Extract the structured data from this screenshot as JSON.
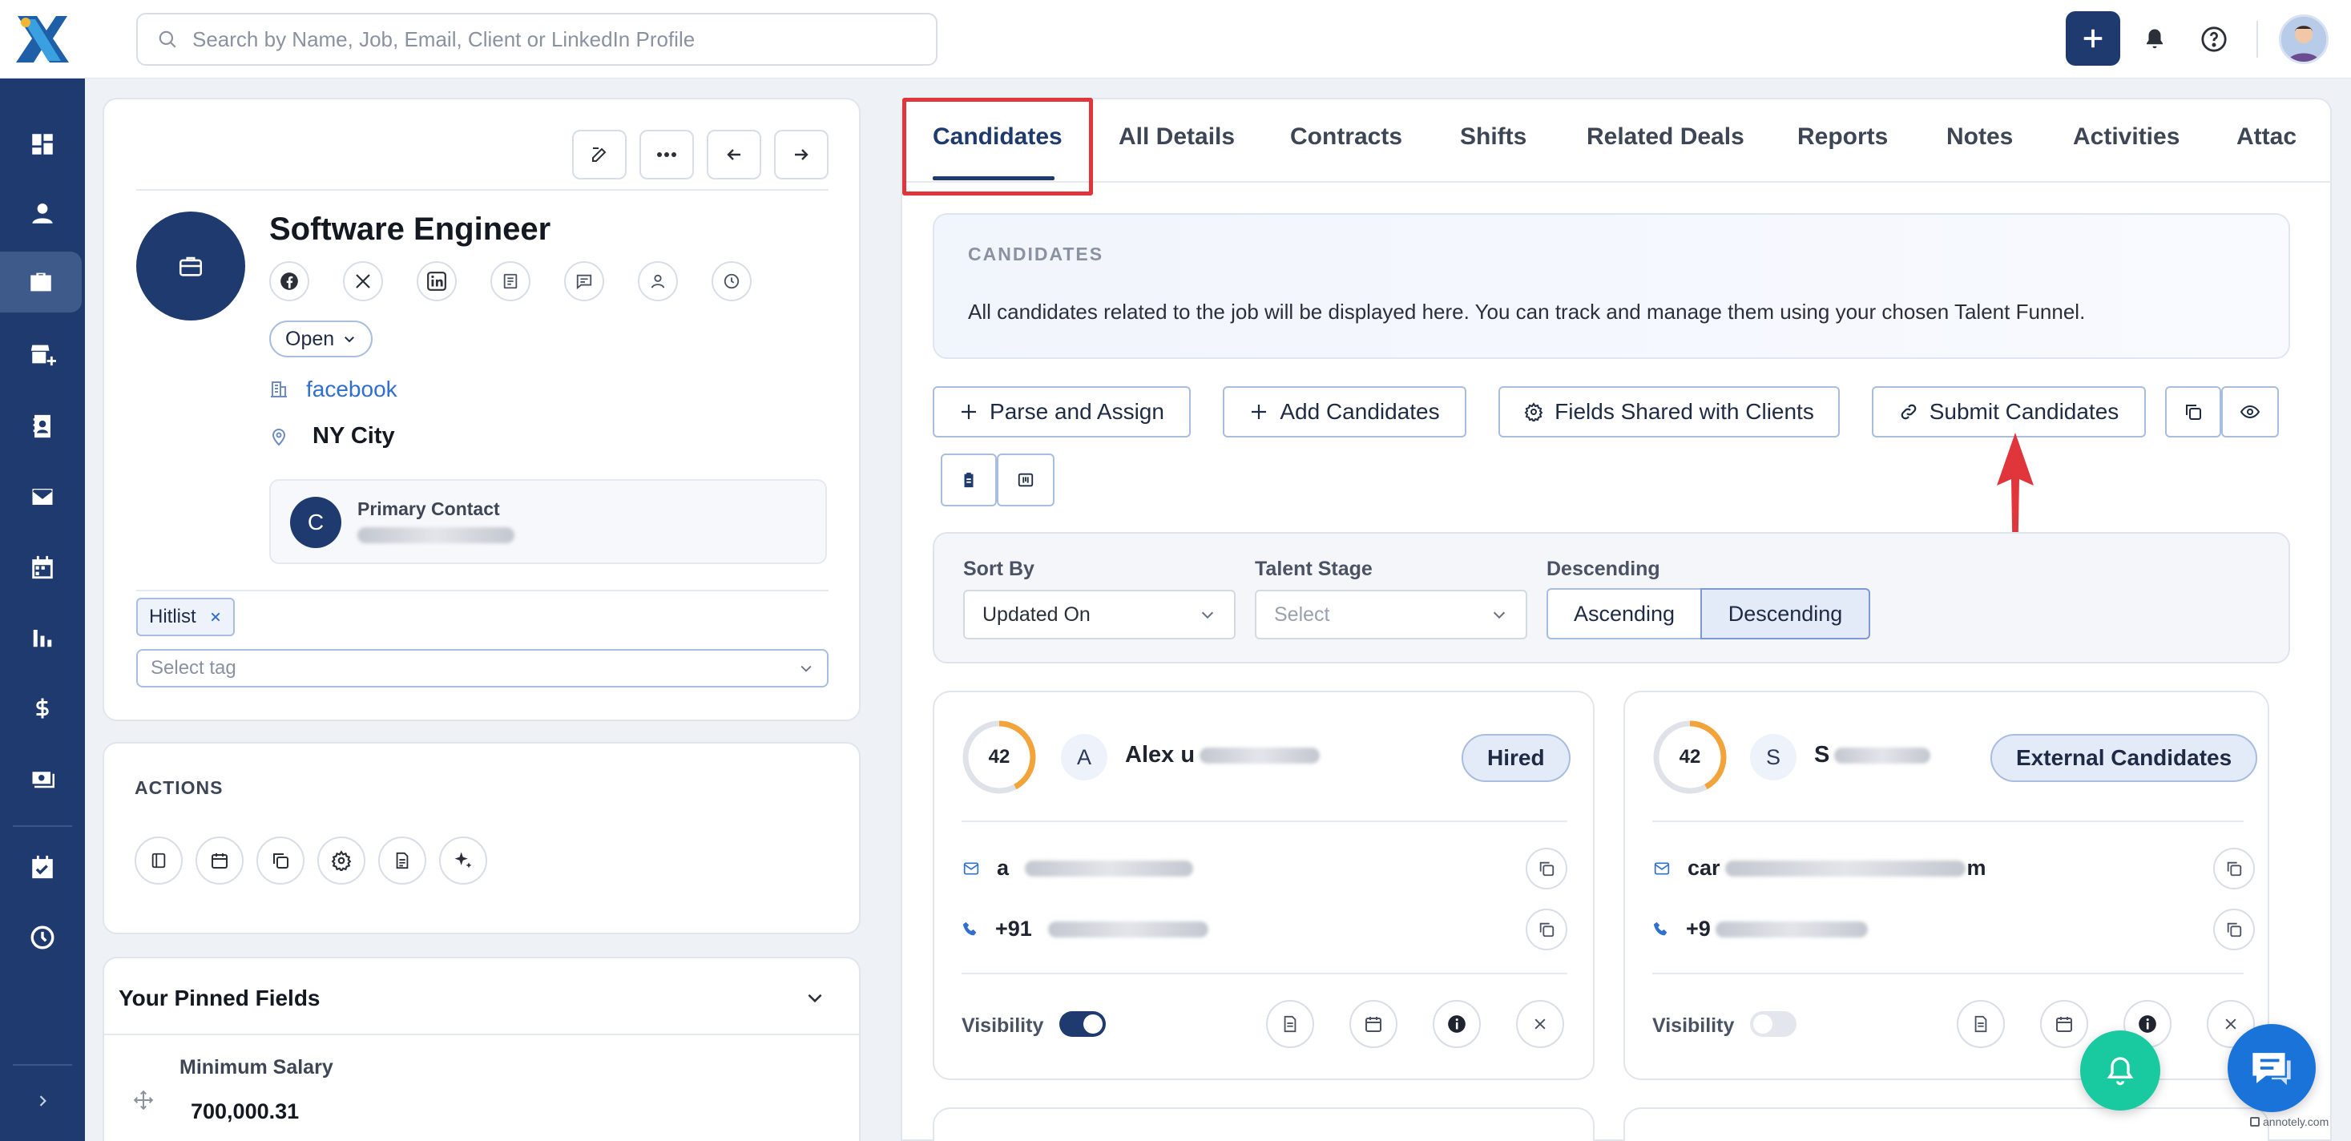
{
  "search": {
    "placeholder": "Search by Name, Job, Email, Client or LinkedIn Profile"
  },
  "job": {
    "title": "Software Engineer",
    "status": "Open",
    "company": "facebook",
    "location": "NY City",
    "primary_contact_label": "Primary Contact",
    "primary_contact_initial": "C",
    "tag": "Hitlist",
    "tag_placeholder": "Select tag"
  },
  "actions": {
    "heading": "ACTIONS"
  },
  "pinned": {
    "heading": "Your Pinned Fields",
    "field_label": "Minimum Salary",
    "field_value": "700,000.31"
  },
  "tabs": [
    "Candidates",
    "All Details",
    "Contracts",
    "Shifts",
    "Related Deals",
    "Reports",
    "Notes",
    "Activities",
    "Attac"
  ],
  "info": {
    "heading": "CANDIDATES",
    "text": "All candidates related to the job will be displayed here. You can track and manage them using your chosen Talent Funnel."
  },
  "buttons": {
    "parse": "Parse and Assign",
    "add": "Add Candidates",
    "fields_shared": "Fields Shared with Clients",
    "submit": "Submit Candidates"
  },
  "filters": {
    "sort_by_label": "Sort By",
    "sort_by_value": "Updated On",
    "stage_label": "Talent Stage",
    "stage_placeholder": "Select",
    "order_label": "Descending",
    "ascending": "Ascending",
    "descending": "Descending"
  },
  "candidates": [
    {
      "score": "42",
      "initial": "A",
      "name": "Alex u",
      "badge": "Hired",
      "email": "a",
      "phone": "+91",
      "visibility_label": "Visibility",
      "visibility_on": true
    },
    {
      "score": "42",
      "initial": "S",
      "name": "S",
      "badge": "External Candidates",
      "email": "car",
      "email_tail": "m",
      "phone": "+9",
      "visibility_label": "Visibility",
      "visibility_on": false
    }
  ],
  "watermark": "annotely.com",
  "colors": {
    "brand": "#1e3a6e",
    "highlight": "#e0353a",
    "score_ring": "#f2a33a",
    "fab": "#19c9a0",
    "chat": "#1a73d9"
  }
}
